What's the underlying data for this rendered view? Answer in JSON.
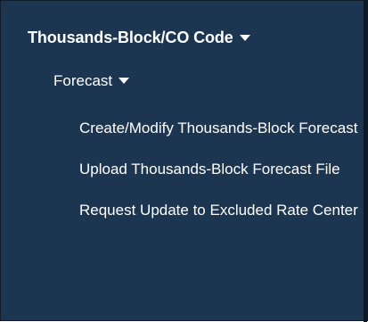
{
  "section": {
    "label": "Thousands-Block/CO Code"
  },
  "forecast": {
    "label": "Forecast"
  },
  "menu": {
    "items": [
      {
        "label": "Create/Modify Thousands-Block Forecast"
      },
      {
        "label": "Upload Thousands-Block Forecast File"
      },
      {
        "label": "Request Update to Excluded Rate Center"
      }
    ]
  },
  "icons": {
    "section_caret": "caret-down-icon",
    "forecast_caret": "caret-down-icon"
  },
  "colors": {
    "background": "#1c3551",
    "text": "#ffffff"
  }
}
